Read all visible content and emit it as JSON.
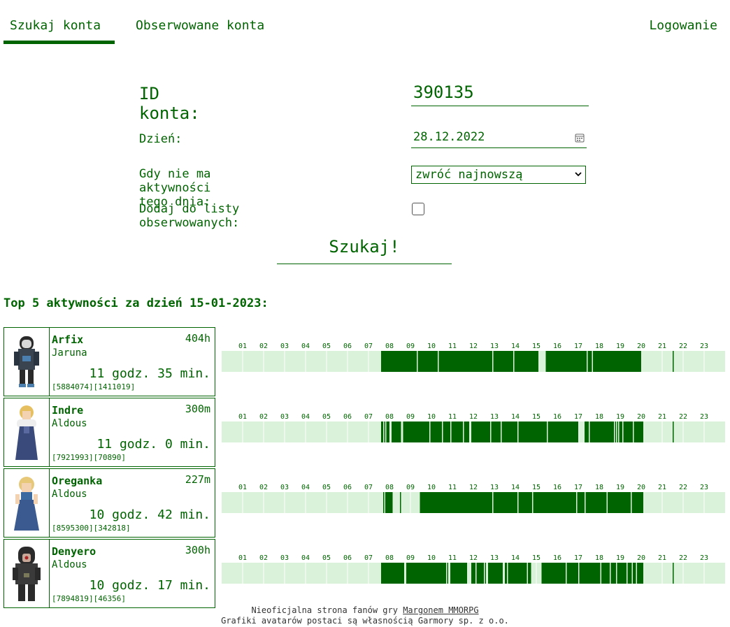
{
  "nav": {
    "tab_search": "Szukaj konta",
    "tab_watched": "Obserwowane konta",
    "login": "Logowanie"
  },
  "form": {
    "id_label": "ID konta:",
    "id_value": "390135",
    "day_label": "Dzień:",
    "day_value": "28.12.2022",
    "no_activity_label": "Gdy nie ma aktywności tego dnia:",
    "no_activity_selected": "zwróć najnowszą",
    "watch_label": "Dodaj do listy obserwowanych:",
    "watch_checked": false,
    "search_button": "Szukaj!"
  },
  "top": {
    "title": "Top 5 aktywności za dzień 15-01-2023:",
    "hours": [
      "01",
      "02",
      "03",
      "04",
      "05",
      "06",
      "07",
      "08",
      "09",
      "10",
      "11",
      "12",
      "13",
      "14",
      "15",
      "16",
      "17",
      "18",
      "19",
      "20",
      "21",
      "22",
      "23"
    ],
    "players": [
      {
        "name": "Arfix",
        "world": "Jaruna",
        "level": "404h",
        "duration": "11 godz. 35 min.",
        "ids": "[5884074][1411019]",
        "avatar": "hooded-knight",
        "activity": [
          [
            7.6,
            8.0
          ],
          [
            8.0,
            9.3
          ],
          [
            9.35,
            10.3
          ],
          [
            10.35,
            11.0
          ],
          [
            11.0,
            12.9
          ],
          [
            12.95,
            13.9
          ],
          [
            13.95,
            15.1
          ],
          [
            15.45,
            16.5
          ],
          [
            16.5,
            17.4
          ],
          [
            17.45,
            17.65
          ],
          [
            17.7,
            19.0
          ],
          [
            19.0,
            20.0
          ],
          [
            21.5,
            21.55
          ]
        ]
      },
      {
        "name": "Indre",
        "world": "Aldous",
        "level": "300m",
        "duration": "11 godz. 0 min.",
        "ids": "[7921993][70890]",
        "avatar": "blonde-woman-fur",
        "activity": [
          [
            7.6,
            7.7
          ],
          [
            7.75,
            7.8
          ],
          [
            7.85,
            8.0
          ],
          [
            8.1,
            8.55
          ],
          [
            8.65,
            9.9
          ],
          [
            9.95,
            10.5
          ],
          [
            10.55,
            10.9
          ],
          [
            10.95,
            11.5
          ],
          [
            11.55,
            11.8
          ],
          [
            11.9,
            12.8
          ],
          [
            12.85,
            13.3
          ],
          [
            13.35,
            14.1
          ],
          [
            14.15,
            15.5
          ],
          [
            15.55,
            17.0
          ],
          [
            17.3,
            17.5
          ],
          [
            17.55,
            18.7
          ],
          [
            18.75,
            18.8
          ],
          [
            18.85,
            18.9
          ],
          [
            18.95,
            19.1
          ],
          [
            19.15,
            19.6
          ],
          [
            19.65,
            20.1
          ],
          [
            21.5,
            21.55
          ]
        ]
      },
      {
        "name": "Oreganka",
        "world": "Aldous",
        "level": "227m",
        "duration": "10 godz. 42 min.",
        "ids": "[8595300][342818]",
        "avatar": "blonde-woman-dress",
        "activity": [
          [
            7.7,
            7.75
          ],
          [
            7.8,
            8.15
          ],
          [
            8.5,
            8.55
          ],
          [
            9.45,
            12.9
          ],
          [
            12.95,
            14.1
          ],
          [
            14.15,
            14.8
          ],
          [
            14.85,
            16.9
          ],
          [
            16.95,
            17.3
          ],
          [
            17.35,
            18.35
          ],
          [
            18.4,
            19.5
          ],
          [
            19.55,
            20.1
          ]
        ]
      },
      {
        "name": "Denyero",
        "world": "Aldous",
        "level": "300h",
        "duration": "10 godz. 17 min.",
        "ids": "[7894819][46356]",
        "avatar": "dark-hooded-rogue",
        "activity": [
          [
            7.6,
            8.7
          ],
          [
            8.8,
            10.7
          ],
          [
            10.75,
            10.8
          ],
          [
            10.9,
            11.7
          ],
          [
            11.9,
            12.1
          ],
          [
            12.15,
            12.5
          ],
          [
            12.55,
            12.6
          ],
          [
            12.7,
            13.4
          ],
          [
            13.5,
            13.6
          ],
          [
            13.65,
            14.55
          ],
          [
            14.6,
            14.75
          ],
          [
            15.25,
            16.4
          ],
          [
            16.45,
            17.0
          ],
          [
            17.05,
            18.05
          ],
          [
            18.1,
            18.5
          ],
          [
            18.55,
            18.8
          ],
          [
            18.85,
            19.3
          ],
          [
            19.35,
            19.55
          ],
          [
            19.6,
            19.75
          ],
          [
            19.8,
            20.1
          ],
          [
            21.5,
            21.55
          ]
        ]
      }
    ]
  },
  "colors": {
    "primary": "#006400",
    "track": "#d9f2d9",
    "track_line": "#ffffff"
  },
  "footer": {
    "line1_prefix": "Nieoficjalna strona fanów gry ",
    "line1_link": "Margonem MMORPG",
    "line2": "Grafiki avatarów postaci są własnością Garmory sp. z o.o."
  }
}
